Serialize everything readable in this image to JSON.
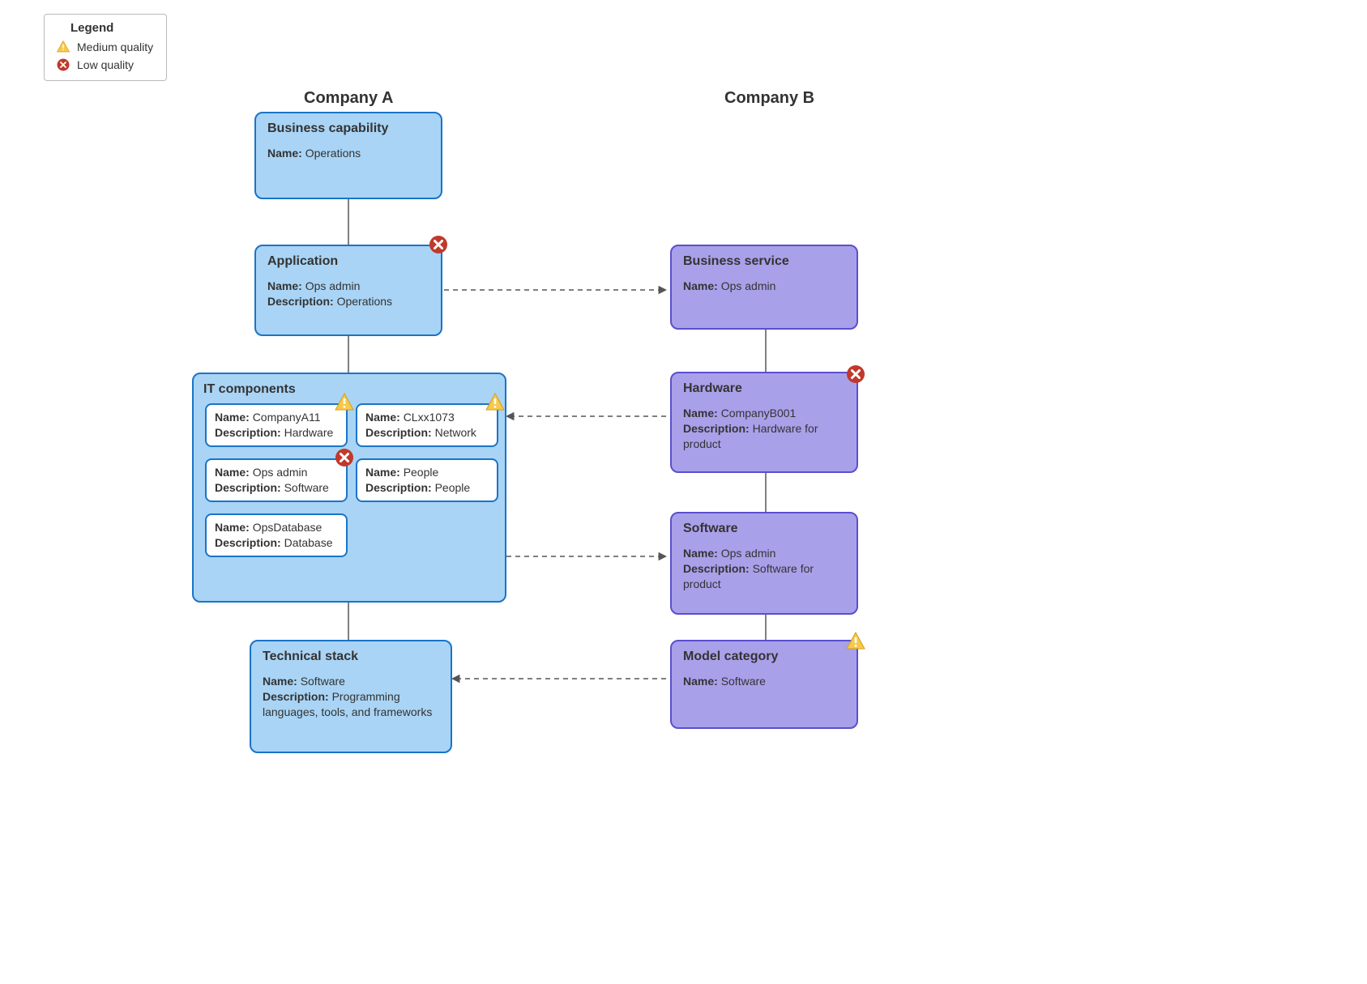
{
  "legend": {
    "title": "Legend",
    "medium": "Medium quality",
    "low": "Low quality"
  },
  "headings": {
    "companyA": "Company A",
    "companyB": "Company B"
  },
  "companyA": {
    "business_capability": {
      "title": "Business capability",
      "name_label": "Name:",
      "name": "Operations"
    },
    "application": {
      "title": "Application",
      "name_label": "Name:",
      "name": "Ops admin",
      "desc_label": "Description:",
      "desc": "Operations"
    },
    "it_components": {
      "title": "IT components",
      "items": [
        {
          "name_label": "Name:",
          "name": "CompanyA11",
          "desc_label": "Description:",
          "desc": "Hardware"
        },
        {
          "name_label": "Name:",
          "name": "CLxx1073",
          "desc_label": "Description:",
          "desc": "Network"
        },
        {
          "name_label": "Name:",
          "name": "Ops admin",
          "desc_label": "Description:",
          "desc": "Software"
        },
        {
          "name_label": "Name:",
          "name": "People",
          "desc_label": "Description:",
          "desc": "People"
        },
        {
          "name_label": "Name:",
          "name": "OpsDatabase",
          "desc_label": "Description:",
          "desc": "Database"
        }
      ]
    },
    "technical_stack": {
      "title": "Technical stack",
      "name_label": "Name:",
      "name": "Software",
      "desc_label": "Description:",
      "desc": "Programming languages, tools, and frameworks"
    }
  },
  "companyB": {
    "business_service": {
      "title": "Business service",
      "name_label": "Name:",
      "name": "Ops admin"
    },
    "hardware": {
      "title": "Hardware",
      "name_label": "Name:",
      "name": "CompanyB001",
      "desc_label": "Description:",
      "desc": "Hardware for product"
    },
    "software": {
      "title": "Software",
      "name_label": "Name:",
      "name": "Ops admin",
      "desc_label": "Description:",
      "desc": "Software for product"
    },
    "model_category": {
      "title": "Model category",
      "name_label": "Name:",
      "name": "Software"
    }
  },
  "badges": {
    "application_low": "low",
    "it_hardware_medium": "medium",
    "it_network_medium": "medium",
    "it_software_low": "low",
    "hardware_low": "low",
    "model_category_medium": "medium"
  }
}
